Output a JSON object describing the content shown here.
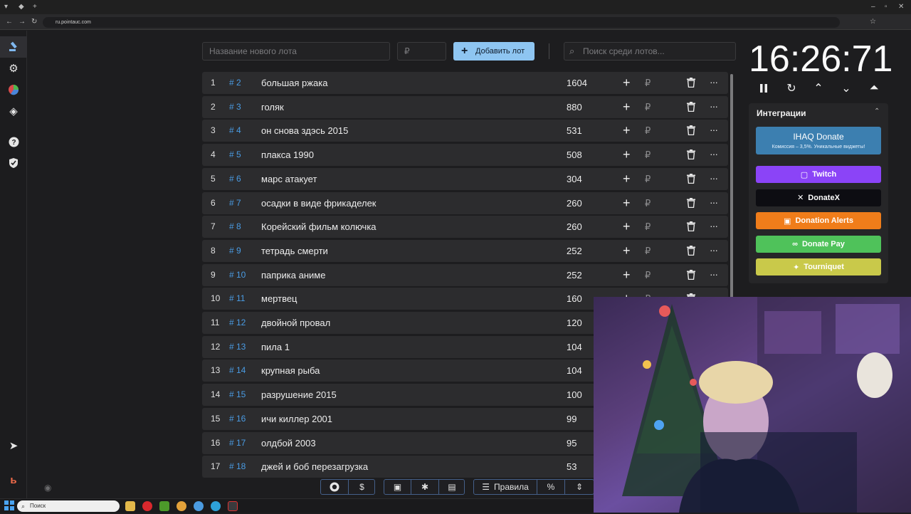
{
  "browser": {
    "url": "ru.pointauc.com"
  },
  "sidebar": {
    "items": [
      "auction-icon",
      "gear-icon",
      "pie-chart-icon",
      "layers-icon",
      "help-icon",
      "shield-icon",
      "telegram-icon",
      "boosty-icon"
    ]
  },
  "toolbar": {
    "lot_name_placeholder": "Название нового лота",
    "amount_placeholder": "₽",
    "add_button_label": "Добавить лот",
    "search_placeholder": "Поиск среди лотов..."
  },
  "lots": [
    {
      "index": "1",
      "id": "# 2",
      "name": "большая ржака",
      "amount": "1604"
    },
    {
      "index": "2",
      "id": "# 3",
      "name": "голяк",
      "amount": "880"
    },
    {
      "index": "3",
      "id": "# 4",
      "name": "он снова здэсь 2015",
      "amount": "531"
    },
    {
      "index": "4",
      "id": "# 5",
      "name": "плакса 1990",
      "amount": "508"
    },
    {
      "index": "5",
      "id": "# 6",
      "name": "марс атакует",
      "amount": "304"
    },
    {
      "index": "6",
      "id": "# 7",
      "name": "осадки в виде фрикаделек",
      "amount": "260"
    },
    {
      "index": "7",
      "id": "# 8",
      "name": "Корейский фильм колючка",
      "amount": "260"
    },
    {
      "index": "8",
      "id": "# 9",
      "name": "тетрадь смерти",
      "amount": "252"
    },
    {
      "index": "9",
      "id": "# 10",
      "name": "паприка аниме",
      "amount": "252"
    },
    {
      "index": "10",
      "id": "# 11",
      "name": "мертвец",
      "amount": "160"
    },
    {
      "index": "11",
      "id": "# 12",
      "name": " двойной провал",
      "amount": "120"
    },
    {
      "index": "12",
      "id": "# 13",
      "name": "пила 1",
      "amount": "104"
    },
    {
      "index": "13",
      "id": "# 14",
      "name": "крупная рыба",
      "amount": "104"
    },
    {
      "index": "14",
      "id": "# 15",
      "name": "разрушение 2015",
      "amount": "100"
    },
    {
      "index": "15",
      "id": "# 16",
      "name": "ичи киллер 2001",
      "amount": "99"
    },
    {
      "index": "16",
      "id": "# 17",
      "name": "олдбой 2003",
      "amount": "95"
    },
    {
      "index": "17",
      "id": "# 18",
      "name": "джей и боб перезагрузка",
      "amount": "53"
    }
  ],
  "row_actions": {
    "plus": "+",
    "currency": "₽",
    "more": "···"
  },
  "bottom_bar": {
    "rules_label": "Правила",
    "percent_label": "%"
  },
  "timer": {
    "display": "16:26:71"
  },
  "integrations": {
    "title": "Интеграции",
    "ihaq_title": "IHAQ Donate",
    "ihaq_subtitle": "Комиссия – 3,5%. Уникальные виджеты!",
    "buttons": [
      {
        "label": "Twitch",
        "color": "#8b44f7"
      },
      {
        "label": "DonateX",
        "color": "#0d0d12"
      },
      {
        "label": "Donation Alerts",
        "color": "#f07d1a"
      },
      {
        "label": "Donate Pay",
        "color": "#4fc25a"
      },
      {
        "label": "Tourniquet",
        "color": "#c9c94a"
      }
    ]
  },
  "taskbar": {
    "search_label": "Поиск"
  }
}
